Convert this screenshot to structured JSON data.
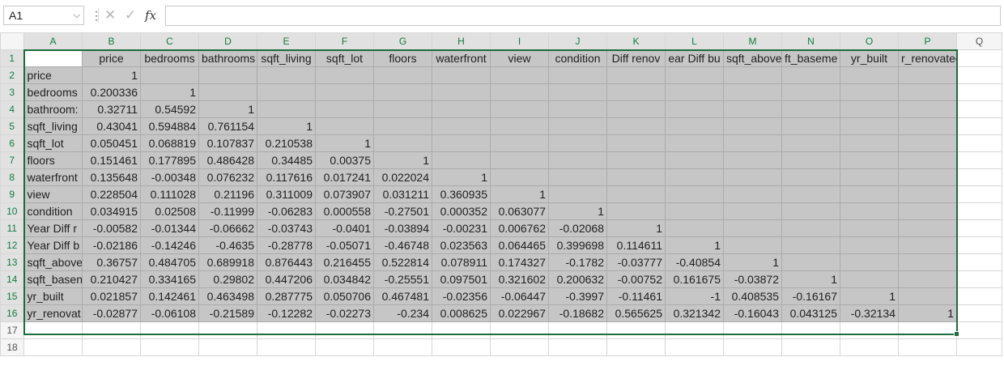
{
  "formula_bar": {
    "name_box": "A1",
    "fx_label": "fx",
    "cancel_glyph": "✕",
    "enter_glyph": "✓",
    "formula": ""
  },
  "columns": [
    "A",
    "B",
    "C",
    "D",
    "E",
    "F",
    "G",
    "H",
    "I",
    "J",
    "K",
    "L",
    "M",
    "N",
    "O",
    "P",
    "Q"
  ],
  "rows": [
    "1",
    "2",
    "3",
    "4",
    "5",
    "6",
    "7",
    "8",
    "9",
    "10",
    "11",
    "12",
    "13",
    "14",
    "15",
    "16",
    "17",
    "18"
  ],
  "header_row": [
    "",
    "price",
    "bedrooms",
    "bathrooms",
    "sqft_living",
    "sqft_lot",
    "floors",
    "waterfront",
    "view",
    "condition",
    "Diff renov",
    "ear Diff bu",
    "sqft_above",
    "ft_baseme",
    "yr_built",
    "r_renovated"
  ],
  "row_labels": [
    "price",
    "bedrooms",
    "bathroom:",
    "sqft_living",
    "sqft_lot",
    "floors",
    "waterfront",
    "view",
    "condition",
    "Year Diff r",
    "Year Diff b",
    "sqft_above",
    "sqft_basen",
    "yr_built",
    "yr_renovat"
  ],
  "matrix": [
    [
      "1"
    ],
    [
      "0.200336",
      "1"
    ],
    [
      "0.32711",
      "0.54592",
      "1"
    ],
    [
      "0.43041",
      "0.594884",
      "0.761154",
      "1"
    ],
    [
      "0.050451",
      "0.068819",
      "0.107837",
      "0.210538",
      "1"
    ],
    [
      "0.151461",
      "0.177895",
      "0.486428",
      "0.34485",
      "0.00375",
      "1"
    ],
    [
      "0.135648",
      "-0.00348",
      "0.076232",
      "0.117616",
      "0.017241",
      "0.022024",
      "1"
    ],
    [
      "0.228504",
      "0.111028",
      "0.21196",
      "0.311009",
      "0.073907",
      "0.031211",
      "0.360935",
      "1"
    ],
    [
      "0.034915",
      "0.02508",
      "-0.11999",
      "-0.06283",
      "0.000558",
      "-0.27501",
      "0.000352",
      "0.063077",
      "1"
    ],
    [
      "-0.00582",
      "-0.01344",
      "-0.06662",
      "-0.03743",
      "-0.0401",
      "-0.03894",
      "-0.00231",
      "0.006762",
      "-0.02068",
      "1"
    ],
    [
      "-0.02186",
      "-0.14246",
      "-0.4635",
      "-0.28778",
      "-0.05071",
      "-0.46748",
      "0.023563",
      "0.064465",
      "0.399698",
      "0.114611",
      "1"
    ],
    [
      "0.36757",
      "0.484705",
      "0.689918",
      "0.876443",
      "0.216455",
      "0.522814",
      "0.078911",
      "0.174327",
      "-0.1782",
      "-0.03777",
      "-0.40854",
      "1"
    ],
    [
      "0.210427",
      "0.334165",
      "0.29802",
      "0.447206",
      "0.034842",
      "-0.25551",
      "0.097501",
      "0.321602",
      "0.200632",
      "-0.00752",
      "0.161675",
      "-0.03872",
      "1"
    ],
    [
      "0.021857",
      "0.142461",
      "0.463498",
      "0.287775",
      "0.050706",
      "0.467481",
      "-0.02356",
      "-0.06447",
      "-0.3997",
      "-0.11461",
      "-1",
      "0.408535",
      "-0.16167",
      "1"
    ],
    [
      "-0.02877",
      "-0.06108",
      "-0.21589",
      "-0.12282",
      "-0.02273",
      "-0.234",
      "0.008625",
      "0.022967",
      "-0.18682",
      "0.565625",
      "0.321342",
      "-0.16043",
      "0.043125",
      "-0.32134",
      "1"
    ]
  ],
  "colors": {
    "selection": "#c6c6c6",
    "accent": "#1e6b3c"
  }
}
